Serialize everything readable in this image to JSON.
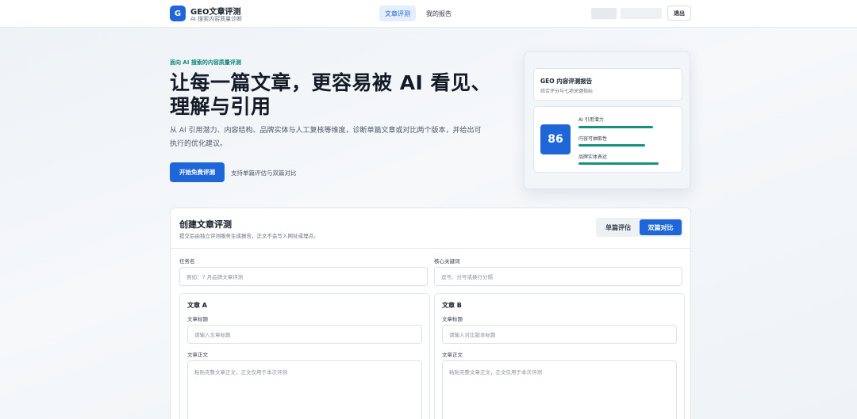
{
  "header": {
    "logo_letter": "G",
    "brand_title": "GEO文章评测",
    "brand_subtitle": "AI 搜索内容质量诊断",
    "nav": [
      {
        "label": "文章评测",
        "active": true
      },
      {
        "label": "我的报告",
        "active": false
      }
    ],
    "logout_label": "退出"
  },
  "hero": {
    "eyebrow": "面向 AI 搜索的内容质量评测",
    "title": "让每一篇文章，更容易被 AI 看见、理解与引用",
    "description": "从 AI 引用潜力、内容结构、品牌实体与人工复核等维度，诊断单篇文章或对比两个版本，并给出可执行的优化建议。",
    "cta_label": "开始免费评测",
    "cta_note": "支持单篇评估与双篇对比"
  },
  "report_preview": {
    "title": "GEO 内容评测报告",
    "subtitle": "综合评分与七项关键指标",
    "score": "86",
    "metrics": [
      {
        "label": "AI 引用潜力",
        "level": 0.8
      },
      {
        "label": "内容可抽取性",
        "level": 0.71
      },
      {
        "label": "品牌实体表达",
        "level": 0.86
      }
    ]
  },
  "form": {
    "title": "创建文章评测",
    "subtitle": "提交后由独立评测服务生成报告，正文不会写入网址或埋点。",
    "mode_options": [
      {
        "label": "单篇评估",
        "active": false
      },
      {
        "label": "双篇对比",
        "active": true
      }
    ],
    "task_name_label": "任务名",
    "task_name_placeholder": "例如：7 月品牌文章评测",
    "keywords_label": "核心关键词",
    "keywords_placeholder": "逗号、分号或换行分隔",
    "article_a": {
      "heading": "文章 A",
      "title_label": "文章标题",
      "title_placeholder": "请输入文章标题",
      "body_label": "文章正文",
      "body_placeholder": "粘贴完整文章正文，正文仅用于本次评测"
    },
    "article_b": {
      "heading": "文章 B",
      "title_label": "文章标题",
      "title_placeholder": "请输入对比版本标题",
      "body_label": "文章正文",
      "body_placeholder": "粘贴完整文章正文，正文仅用于本次评测"
    }
  },
  "colors": {
    "accent": "#1f66d9",
    "teal": "#14927f"
  }
}
